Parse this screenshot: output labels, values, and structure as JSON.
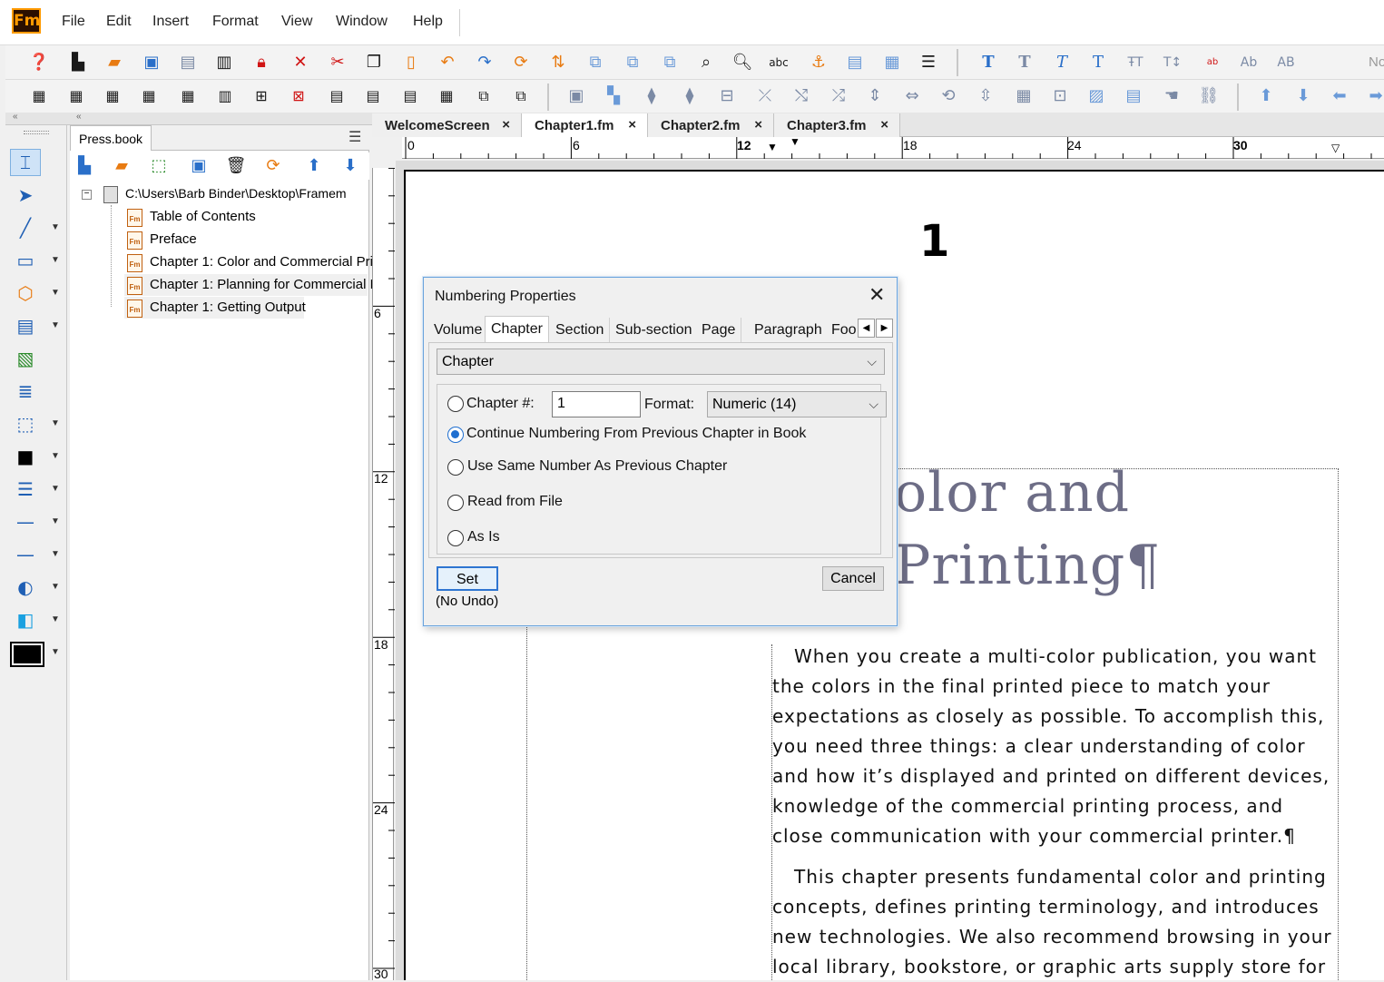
{
  "app": {
    "logo": "Fm"
  },
  "menu": [
    "File",
    "Edit",
    "Insert",
    "Format",
    "View",
    "Window",
    "Help"
  ],
  "toolbar_truncated_label": "No",
  "book_panel": {
    "tab_label": "Press.book",
    "root_path": "C:\\Users\\Barb Binder\\Desktop\\Framem",
    "items": [
      "Table of Contents",
      "Preface",
      "Chapter 1: Color and Commercial Pri",
      "Chapter 1: Planning for Commercial F",
      "Chapter 1: Getting Output"
    ]
  },
  "doc_tabs": [
    "WelcomeScreen",
    "Chapter1.fm",
    "Chapter2.fm",
    "Chapter3.fm"
  ],
  "ruler_h_labels": [
    "0",
    "6",
    "12",
    "18",
    "24",
    "30"
  ],
  "ruler_v_labels": [
    "6",
    "12",
    "18",
    "24",
    "30"
  ],
  "document": {
    "page_number": "1",
    "heading_line1": "olor and",
    "heading_line2": "Printing¶",
    "para1": "When you create a multi-color publication, you want the colors in the final printed piece to match your expectations as closely as possible. To accomplish this, you need three things: a clear understanding of color and how it’s displayed and printed on different devices, knowledge of the commercial printing process, and close communication with your commercial printer.¶",
    "para2": "This chapter presents fundamental color and printing concepts, defines printing terminology, and introduces new technologies. We also recommend browsing in your local library, bookstore, or graphic arts supply store for"
  },
  "dialog": {
    "title": "Numbering Properties",
    "tabs": [
      "Volume",
      "Chapter",
      "Section",
      "Sub-section",
      "Page",
      "Paragraph",
      "Foo"
    ],
    "active_tab": "Chapter",
    "type_select": "Chapter",
    "chapter_num_label": "Chapter #:",
    "chapter_num_value": "1",
    "format_label": "Format:",
    "format_value": "Numeric  (14)",
    "options": [
      "Continue Numbering From Previous Chapter in Book",
      "Use Same Number As Previous Chapter",
      "Read from File",
      "As Is"
    ],
    "selected_option": "Continue Numbering From Previous Chapter in Book",
    "set_label": "Set",
    "no_undo": "(No Undo)",
    "cancel_label": "Cancel"
  }
}
